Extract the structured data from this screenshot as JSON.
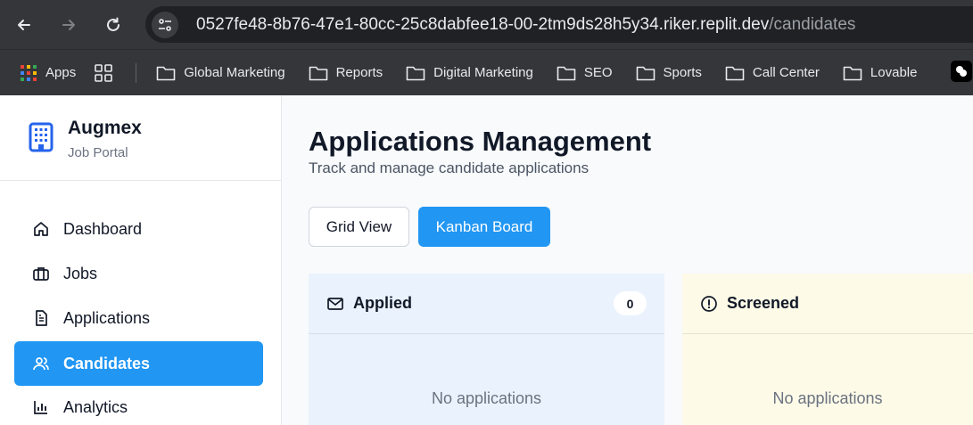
{
  "browser": {
    "url_host": "0527fe48-8b76-47e1-80cc-25c8dabfee18-00-2tm9ds28h5y34.riker.replit.dev",
    "url_path": "/candidates",
    "bookmarks": [
      {
        "label": "Apps",
        "icon": "apps-grid-icon"
      },
      {
        "label": "Global Marketing",
        "icon": "folder-icon"
      },
      {
        "label": "Reports",
        "icon": "folder-icon"
      },
      {
        "label": "Digital Marketing",
        "icon": "folder-icon"
      },
      {
        "label": "SEO",
        "icon": "folder-icon"
      },
      {
        "label": "Sports",
        "icon": "folder-icon"
      },
      {
        "label": "Call Center",
        "icon": "folder-icon"
      },
      {
        "label": "Lovable",
        "icon": "folder-icon"
      }
    ]
  },
  "sidebar": {
    "brand": {
      "name": "Augmex",
      "subtitle": "Job Portal"
    },
    "items": [
      {
        "label": "Dashboard",
        "icon": "home-icon",
        "active": false
      },
      {
        "label": "Jobs",
        "icon": "briefcase-icon",
        "active": false
      },
      {
        "label": "Applications",
        "icon": "document-icon",
        "active": false
      },
      {
        "label": "Candidates",
        "icon": "users-icon",
        "active": true
      },
      {
        "label": "Analytics",
        "icon": "bar-chart-icon",
        "active": false
      }
    ]
  },
  "main": {
    "title": "Applications Management",
    "subtitle": "Track and manage candidate applications",
    "view_buttons": {
      "grid": "Grid View",
      "kanban": "Kanban Board",
      "active": "kanban"
    },
    "columns": [
      {
        "title": "Applied",
        "icon": "mail-icon",
        "count": "0",
        "empty": "No applications",
        "color": "#eaf3fd"
      },
      {
        "title": "Screened",
        "icon": "alert-circle-icon",
        "empty": "No applications",
        "color": "#fdfae8"
      }
    ]
  },
  "colors": {
    "accent": "#2196f3",
    "chrome": "#35363a"
  }
}
